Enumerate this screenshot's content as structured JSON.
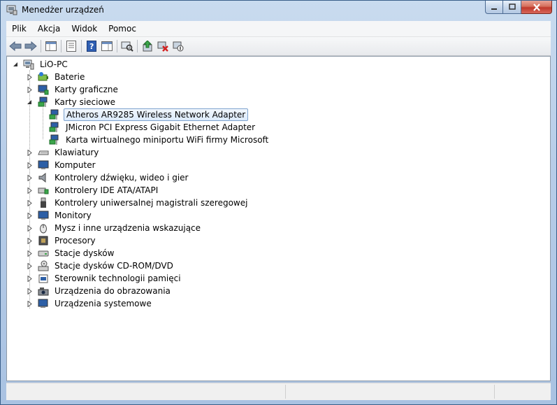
{
  "window": {
    "title": "Menedżer urządzeń"
  },
  "menu": [
    {
      "label": "Plik"
    },
    {
      "label": "Akcja"
    },
    {
      "label": "Widok"
    },
    {
      "label": "Pomoc"
    }
  ],
  "toolbar": [
    {
      "icon": "back-arrow-icon"
    },
    {
      "icon": "forward-arrow-icon"
    },
    {
      "icon": "show-hide-console-tree-icon"
    },
    {
      "icon": "properties-icon"
    },
    {
      "icon": "help-icon"
    },
    {
      "icon": "show-action-pane-icon"
    },
    {
      "icon": "scan-hardware-changes-icon"
    },
    {
      "icon": "update-driver-icon"
    },
    {
      "icon": "uninstall-icon"
    },
    {
      "icon": "disable-device-icon"
    }
  ],
  "tree": {
    "root": {
      "label": "LiO-PC",
      "icon": "computer-icon"
    },
    "items": [
      {
        "label": "Baterie",
        "icon": "battery-icon",
        "expanded": false
      },
      {
        "label": "Karty graficzne",
        "icon": "display-adapter-icon",
        "expanded": false
      },
      {
        "label": "Karty sieciowe",
        "icon": "network-adapter-icon",
        "expanded": true,
        "children": [
          {
            "label": "Atheros AR9285 Wireless Network Adapter",
            "icon": "network-adapter-icon",
            "selected": true
          },
          {
            "label": "JMicron PCI Express Gigabit Ethernet Adapter",
            "icon": "network-adapter-icon"
          },
          {
            "label": "Karta wirtualnego miniportu WiFi firmy Microsoft",
            "icon": "network-adapter-icon"
          }
        ]
      },
      {
        "label": "Klawiatury",
        "icon": "keyboard-icon",
        "expanded": false
      },
      {
        "label": "Komputer",
        "icon": "computer-monitor-icon",
        "expanded": false
      },
      {
        "label": "Kontrolery dźwięku, wideo i gier",
        "icon": "speaker-icon",
        "expanded": false
      },
      {
        "label": "Kontrolery IDE ATA/ATAPI",
        "icon": "ide-controller-icon",
        "expanded": false
      },
      {
        "label": "Kontrolery uniwersalnej magistrali szeregowej",
        "icon": "usb-icon",
        "expanded": false
      },
      {
        "label": "Monitory",
        "icon": "monitor-icon",
        "expanded": false
      },
      {
        "label": "Mysz i inne urządzenia wskazujące",
        "icon": "mouse-icon",
        "expanded": false
      },
      {
        "label": "Procesory",
        "icon": "processor-icon",
        "expanded": false
      },
      {
        "label": "Stacje dysków",
        "icon": "disk-drive-icon",
        "expanded": false
      },
      {
        "label": "Stacje dysków CD-ROM/DVD",
        "icon": "cdrom-icon",
        "expanded": false
      },
      {
        "label": "Sterownik technologii pamięci",
        "icon": "memory-tech-icon",
        "expanded": false
      },
      {
        "label": "Urządzenia do obrazowania",
        "icon": "imaging-device-icon",
        "expanded": false
      },
      {
        "label": "Urządzenia systemowe",
        "icon": "system-device-icon",
        "expanded": false
      }
    ]
  },
  "colors": {
    "selection": "#dcebfc",
    "selection_border": "#7da2ce",
    "frame": "#b7cde8"
  }
}
